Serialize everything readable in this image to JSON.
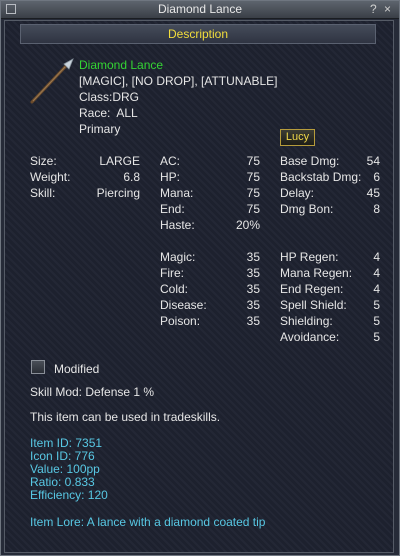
{
  "window": {
    "title": "Diamond Lance",
    "help_label": "?",
    "close_label": "×"
  },
  "header": {
    "label": "Description"
  },
  "item": {
    "name": "Diamond Lance",
    "flags": "[MAGIC], [NO DROP], [ATTUNABLE]",
    "class": "Class:DRG",
    "race": "Race:  ALL",
    "slot": "Primary",
    "icon": "lance-icon"
  },
  "lucy_button": {
    "label": "Lucy"
  },
  "col1": [
    {
      "label": "Size:",
      "value": "LARGE"
    },
    {
      "label": "Weight:",
      "value": "6.8"
    },
    {
      "label": "Skill:",
      "value": "Piercing"
    }
  ],
  "col2a": [
    {
      "label": "AC:",
      "value": "75"
    },
    {
      "label": "HP:",
      "value": "75"
    },
    {
      "label": "Mana:",
      "value": "75"
    },
    {
      "label": "End:",
      "value": "75"
    },
    {
      "label": "Haste:",
      "value": "20%"
    }
  ],
  "col2b": [
    {
      "label": "Magic:",
      "value": "35"
    },
    {
      "label": "Fire:",
      "value": "35"
    },
    {
      "label": "Cold:",
      "value": "35"
    },
    {
      "label": "Disease:",
      "value": "35"
    },
    {
      "label": "Poison:",
      "value": "35"
    }
  ],
  "col3a": [
    {
      "label": "Base Dmg:",
      "value": "54"
    },
    {
      "label": "Backstab Dmg:",
      "value": "6"
    },
    {
      "label": "Delay:",
      "value": "45"
    },
    {
      "label": "Dmg Bon:",
      "value": "8"
    }
  ],
  "col3b": [
    {
      "label": "HP Regen:",
      "value": "4"
    },
    {
      "label": "Mana Regen:",
      "value": "4"
    },
    {
      "label": "End Regen:",
      "value": "4"
    },
    {
      "label": "Spell Shield:",
      "value": "5"
    },
    {
      "label": "Shielding:",
      "value": "5"
    },
    {
      "label": "Avoidance:",
      "value": "5"
    }
  ],
  "modified": {
    "label": "Modified",
    "checked": false
  },
  "skill_mod": "Skill Mod: Defense 1 %",
  "tradeskill_note": "This item can be used in tradeskills.",
  "info": {
    "item_id": "Item ID: 7351",
    "icon_id": "Icon ID: 776",
    "value": "Value: 100pp",
    "ratio": "Ratio: 0.833",
    "efficiency": "Efficiency: 120"
  },
  "lore": "Item Lore: A lance with a diamond coated tip",
  "colors": {
    "name": "#33d433",
    "info": "#58c8e4",
    "header": "#f2dd3c",
    "text": "#e6e6e6"
  }
}
